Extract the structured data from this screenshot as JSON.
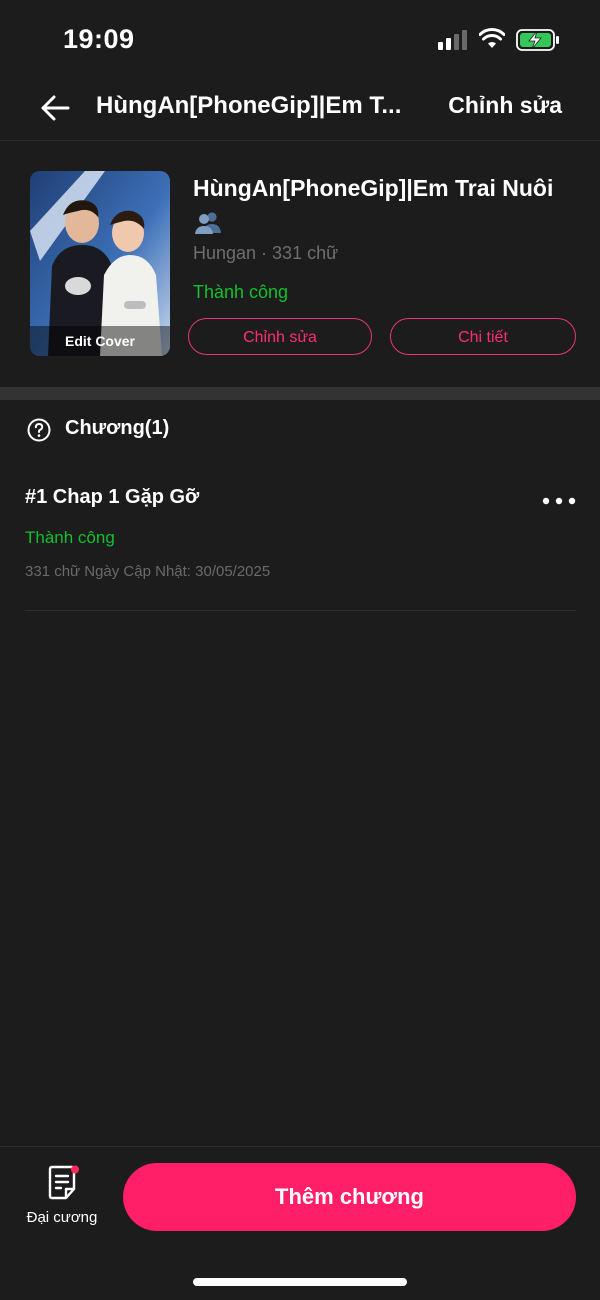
{
  "status_bar": {
    "time": "19:09",
    "icons": [
      "signal-icon",
      "wifi-icon",
      "battery-charging-icon"
    ]
  },
  "nav": {
    "title": "HùngAn[PhoneGip]|Em T...",
    "edit_label": "Chỉnh sửa"
  },
  "story": {
    "title": "HùngAn[PhoneGip]|Em Trai Nuôi",
    "title_emoji": "people-emoji-icon",
    "meta": "Hungan · 331 chữ",
    "status": "Thành công",
    "edit_cover_label": "Edit Cover",
    "edit_button": "Chỉnh sửa",
    "detail_button": "Chi tiết"
  },
  "chapters_section": {
    "header": "Chương(1)",
    "items": [
      {
        "title": "#1 Chap 1 Gặp Gỡ",
        "status": "Thành công",
        "meta": "331 chữ Ngày Cập Nhật: 30/05/2025"
      }
    ]
  },
  "bottom": {
    "outline_label": "Đại cương",
    "add_chapter": "Thêm chương"
  },
  "colors": {
    "background": "#1c1c1c",
    "accent": "#ff1e67",
    "success": "#13c02d",
    "muted": "#6e6e6e"
  }
}
